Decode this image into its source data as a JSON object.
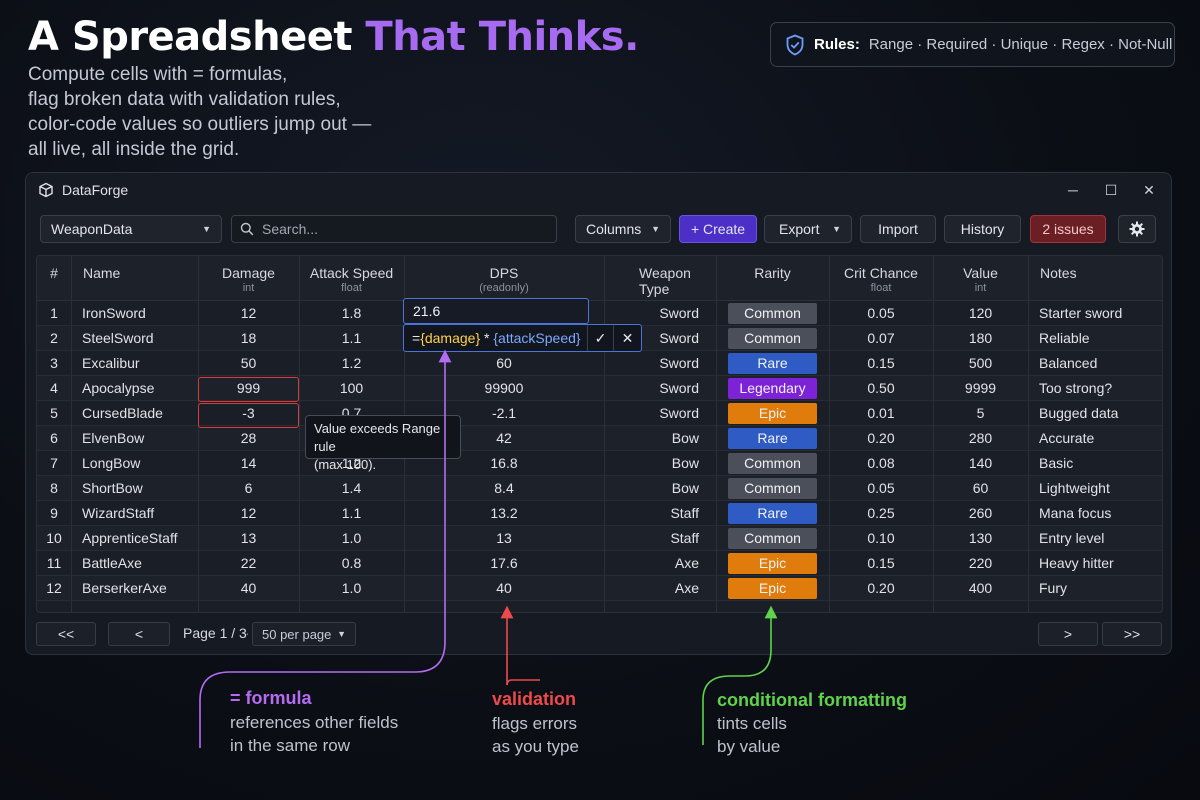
{
  "hero": {
    "title_part1": "A Spreadsheet ",
    "title_part2": "That Thinks.",
    "subtitle_lines": [
      "Compute cells with = formulas,",
      "flag broken data with validation rules,",
      "color-code values so outliers jump out —",
      "all live, all inside the grid."
    ]
  },
  "rules": {
    "label": "Rules:",
    "items": "Range · Required · Unique · Regex · Not-Null",
    "icon": "shield-check-icon"
  },
  "window": {
    "app_name": "DataForge",
    "app_icon": "cube-icon",
    "minimize": "─",
    "maximize": "☐",
    "close": "✕"
  },
  "toolbar": {
    "table_select": "WeaponData",
    "search_placeholder": "Search...",
    "columns_label": "Columns",
    "create_label": "+ Create",
    "export_label": "Export",
    "import_label": "Import",
    "history_label": "History",
    "issues_label": "2 issues",
    "settings_icon": "gear-icon",
    "colors": {
      "create": "#4b2fc7",
      "issues": "#6b1f24"
    }
  },
  "grid": {
    "columns": [
      {
        "name": "#",
        "type": ""
      },
      {
        "name": "Name",
        "type": ""
      },
      {
        "name": "Damage",
        "type": "int"
      },
      {
        "name": "Attack Speed",
        "type": "float"
      },
      {
        "name": "DPS",
        "type": "(readonly)"
      },
      {
        "name": "Weapon Type",
        "type": ""
      },
      {
        "name": "Rarity",
        "type": ""
      },
      {
        "name": "Crit Chance",
        "type": "float"
      },
      {
        "name": "Value",
        "type": "int"
      },
      {
        "name": "Notes",
        "type": ""
      }
    ],
    "rows": [
      {
        "num": "1",
        "name": "IronSword",
        "damage": "12",
        "speed": "1.8",
        "dps": "21.6",
        "wtype": "Sword",
        "rarity": "Common",
        "crit": "0.05",
        "value": "120",
        "notes": "Starter sword"
      },
      {
        "num": "2",
        "name": "SteelSword",
        "damage": "18",
        "speed": "1.1",
        "dps": "",
        "wtype": "Sword",
        "rarity": "Common",
        "crit": "0.07",
        "value": "180",
        "notes": "Reliable"
      },
      {
        "num": "3",
        "name": "Excalibur",
        "damage": "50",
        "speed": "1.2",
        "dps": "60",
        "wtype": "Sword",
        "rarity": "Rare",
        "crit": "0.15",
        "value": "500",
        "notes": "Balanced"
      },
      {
        "num": "4",
        "name": "Apocalypse",
        "damage": "999",
        "speed": "100",
        "dps": "99900",
        "wtype": "Sword",
        "rarity": "Legendary",
        "crit": "0.50",
        "value": "9999",
        "notes": "Too strong?"
      },
      {
        "num": "5",
        "name": "CursedBlade",
        "damage": "-3",
        "speed": "0.7",
        "dps": "-2.1",
        "wtype": "Sword",
        "rarity": "Epic",
        "crit": "0.01",
        "value": "5",
        "notes": "Bugged data"
      },
      {
        "num": "6",
        "name": "ElvenBow",
        "damage": "28",
        "speed": "",
        "dps": "42",
        "wtype": "Bow",
        "rarity": "Rare",
        "crit": "0.20",
        "value": "280",
        "notes": "Accurate"
      },
      {
        "num": "7",
        "name": "LongBow",
        "damage": "14",
        "speed": "1.2",
        "dps": "16.8",
        "wtype": "Bow",
        "rarity": "Common",
        "crit": "0.08",
        "value": "140",
        "notes": "Basic"
      },
      {
        "num": "8",
        "name": "ShortBow",
        "damage": "6",
        "speed": "1.4",
        "dps": "8.4",
        "wtype": "Bow",
        "rarity": "Common",
        "crit": "0.05",
        "value": "60",
        "notes": "Lightweight"
      },
      {
        "num": "9",
        "name": "WizardStaff",
        "damage": "12",
        "speed": "1.1",
        "dps": "13.2",
        "wtype": "Staff",
        "rarity": "Rare",
        "crit": "0.25",
        "value": "260",
        "notes": "Mana focus"
      },
      {
        "num": "10",
        "name": "ApprenticeStaff",
        "damage": "13",
        "speed": "1.0",
        "dps": "13",
        "wtype": "Staff",
        "rarity": "Common",
        "crit": "0.10",
        "value": "130",
        "notes": "Entry level"
      },
      {
        "num": "11",
        "name": "BattleAxe",
        "damage": "22",
        "speed": "0.8",
        "dps": "17.6",
        "wtype": "Axe",
        "rarity": "Epic",
        "crit": "0.15",
        "value": "220",
        "notes": "Heavy hitter"
      },
      {
        "num": "12",
        "name": "BerserkerAxe",
        "damage": "40",
        "speed": "1.0",
        "dps": "40",
        "wtype": "Axe",
        "rarity": "Epic",
        "crit": "0.20",
        "value": "400",
        "notes": "Fury"
      }
    ],
    "rarity_colors": {
      "Common": "#4a4f5a",
      "Rare": "#2f5cc4",
      "Epic": "#e07c0c",
      "Legendary": "#7d22d6"
    },
    "error_cells": [
      {
        "row": 3,
        "col": "damage"
      },
      {
        "row": 4,
        "col": "damage"
      }
    ],
    "editing": {
      "value": "21.6",
      "formula_eq": "=",
      "formula_field1": "{damage}",
      "formula_op": " * ",
      "formula_field2": "{attackSpeed}",
      "confirm": "✓",
      "cancel": "✕"
    },
    "tooltip_lines": [
      "Value exceeds Range rule",
      "(max 100)."
    ]
  },
  "pager": {
    "first": "<<",
    "prev": "<",
    "page_info": "Page 1 / 3",
    "per_page": "50 per page",
    "next": ">",
    "last": ">>"
  },
  "annotations": {
    "formula": {
      "title": "= formula",
      "lines": [
        "references other fields",
        "in the same row"
      ],
      "color": "#b56cf2"
    },
    "validation": {
      "title": "validation",
      "lines": [
        "flags errors",
        "as you type"
      ],
      "color": "#ef4a4a"
    },
    "formatting": {
      "title": "conditional formatting",
      "lines": [
        "tints cells",
        "by value"
      ],
      "color": "#5ed34b"
    }
  }
}
